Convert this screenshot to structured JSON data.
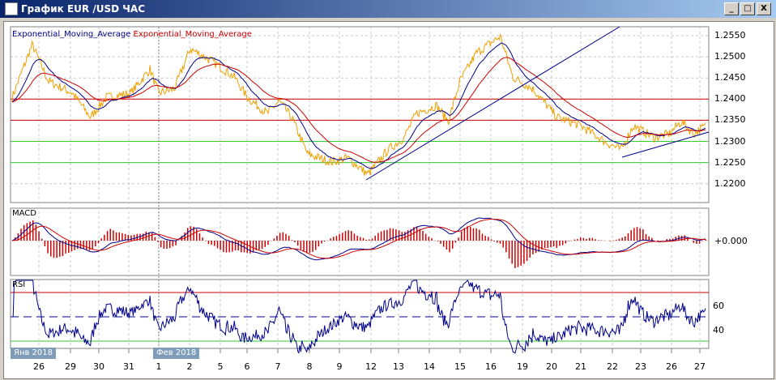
{
  "window": {
    "title": "График EUR /USD ЧАС",
    "minimize": "_",
    "maximize": "□",
    "close": "X"
  },
  "main_panel": {
    "legend": [
      "Exponential_Moving_Average",
      "Exponential_Moving_Average"
    ],
    "y_ticks": [
      "1.2550",
      "1.2500",
      "1.2450",
      "1.2400",
      "1.2350",
      "1.2300",
      "1.2250",
      "1.2200"
    ]
  },
  "macd_panel": {
    "label": "MACD",
    "zero_label": "+0.000"
  },
  "rsi_panel": {
    "label": "RSI",
    "ticks": [
      "60",
      "40"
    ]
  },
  "x_axis": {
    "months": [
      "Янв 2018",
      "Фев 2018"
    ],
    "dates": [
      "26",
      "29",
      "30",
      "31",
      "1",
      "2",
      "5",
      "6",
      "7",
      "8",
      "9",
      "12",
      "13",
      "14",
      "15",
      "16",
      "19",
      "20",
      "21",
      "22",
      "23",
      "26",
      "27"
    ]
  },
  "colors": {
    "price": "#f0a000",
    "ema_fast": "#00008b",
    "ema_slow": "#cc0000",
    "resistance": "#cc0000",
    "support": "#33cc33",
    "trend": "#00008b"
  },
  "chart_data": {
    "type": "line",
    "title": "EUR/USD hourly",
    "ylim": [
      1.219,
      1.257
    ],
    "levels": {
      "red": [
        1.24,
        1.235
      ],
      "green": [
        1.23,
        1.225
      ]
    },
    "rsi_levels": [
      70,
      50,
      30
    ],
    "price_keypoints": [
      [
        0,
        1.2404
      ],
      [
        2.9,
        1.2529
      ],
      [
        5.2,
        1.2443
      ],
      [
        8.7,
        1.2414
      ],
      [
        11.3,
        1.2357
      ],
      [
        13.6,
        1.2404
      ],
      [
        17.1,
        1.2414
      ],
      [
        19.9,
        1.2471
      ],
      [
        21.1,
        1.2414
      ],
      [
        23.4,
        1.2424
      ],
      [
        25.7,
        1.2519
      ],
      [
        28.7,
        1.2491
      ],
      [
        32.1,
        1.2452
      ],
      [
        33.9,
        1.2404
      ],
      [
        36.8,
        1.2366
      ],
      [
        38.5,
        1.2395
      ],
      [
        40.3,
        1.2357
      ],
      [
        42.6,
        1.227
      ],
      [
        46.1,
        1.2251
      ],
      [
        48.4,
        1.2261
      ],
      [
        51.3,
        1.2222
      ],
      [
        54.2,
        1.228
      ],
      [
        56.5,
        1.2309
      ],
      [
        58.3,
        1.2366
      ],
      [
        61.2,
        1.2385
      ],
      [
        62.9,
        1.2347
      ],
      [
        64.6,
        1.2443
      ],
      [
        67,
        1.251
      ],
      [
        70.4,
        1.2548
      ],
      [
        72.2,
        1.2452
      ],
      [
        75.1,
        1.2424
      ],
      [
        78.6,
        1.2357
      ],
      [
        82,
        1.2337
      ],
      [
        85.5,
        1.2299
      ],
      [
        87.8,
        1.228
      ],
      [
        89.6,
        1.2337
      ],
      [
        92.5,
        1.2309
      ],
      [
        94.8,
        1.2318
      ],
      [
        96.5,
        1.2347
      ],
      [
        98.3,
        1.2318
      ],
      [
        100,
        1.2337
      ]
    ]
  }
}
